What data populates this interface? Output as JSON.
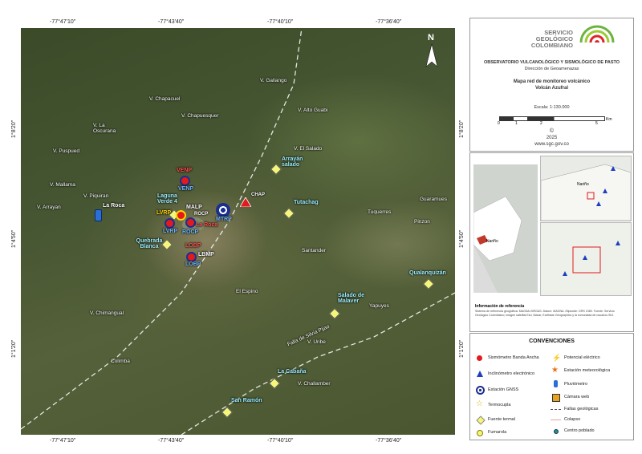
{
  "coords": {
    "top": [
      "-77°47'10\"",
      "-77°43'40\"",
      "-77°40'10\"",
      "-77°36'40\""
    ],
    "bottom": [
      "-77°47'10\"",
      "-77°43'40\"",
      "-77°40'10\"",
      "-77°36'40\""
    ],
    "left": [
      "1°8'20\"",
      "1°4'50\"",
      "1°1'20\""
    ],
    "right": [
      "1°8'20\"",
      "1°4'50\"",
      "1°1'20\""
    ]
  },
  "north": "N",
  "places": [
    "V. Chapacuel",
    "V. Chapuesquer",
    "V. Gallango",
    "V. Alto Guabi",
    "V. El Salado",
    "V. La Oscurana",
    "V. Puspued",
    "V. Mallama",
    "V. Piquiran",
    "V. Arrayan",
    "Guaramues",
    "Tuquerres",
    "Pinzon",
    "Santander",
    "El Espino",
    "Yapuyes",
    "V. Chimangual",
    "V. Uribe",
    "Colimba",
    "V. Challamber"
  ],
  "sites": {
    "arrayan": "Arrayán salado",
    "tutachag": "Tutachag",
    "laguna": "Laguna Verde 4",
    "laroca_gauge": "La Roca",
    "laroca": "La Roca",
    "quebrada": "Quebrada Blanca",
    "salado": "Salado de Malaver",
    "qualanquizan": "Qualanquizán",
    "cabana": "La Cabaña",
    "sanramon": "San Ramón",
    "falla": "Falla de Silvia Pijao"
  },
  "stations": {
    "venp_top": "VENP",
    "venp_bot": "VENP",
    "malp": "MALP",
    "rocp_top": "ROCP",
    "lvrp_top": "LVRP",
    "lvrp_bot": "LVRP",
    "rocp_bot": "ROCP",
    "mtrp": "MTRP",
    "chap": "CHAP",
    "lobp_top": "LOBP",
    "lbmp": "LBMP",
    "lobp_bot": "LOBP"
  },
  "title": {
    "org_line1": "SERVICIO",
    "org_line2": "GEOLÓGICO",
    "org_line3": "COLOMBIANO",
    "observatory": "OBSERVATORIO VULCANOLÓGICO Y SISMOLÓGICO DE PASTO",
    "direction": "Dirección de Geoamenazas",
    "map_title": "Mapa red de monitoreo volcánico",
    "volcano": "Volcán Azufral",
    "scale": "Escala: 1:130.000",
    "scale_ticks": [
      "0",
      "1",
      "2",
      "5"
    ],
    "scale_unit": "Km",
    "copyright": "©",
    "year": "2025",
    "url": "www.sgc.gov.co"
  },
  "reference": {
    "inset_label_1": "Nariño",
    "inset_label_2": "Nariño",
    "heading": "Información de referencia",
    "text": "Sistema de referencia geográfica: MAGNA-SIRGAS. Datum: MAGNA. Elipsoide: GRS 1980. Fuente: Servicio Geológico Colombiano; imagen satelital Esri, Maxar, Earthstar Geographics y la comunidad de usuarios SIG."
  },
  "legend": {
    "heading": "CONVENCIONES",
    "items_left": [
      "Sismómetro Banda Ancha",
      "Inclinómetro electrónico",
      "Estación GNSS",
      "Termocupla",
      "Fuente termal",
      "Fumarola"
    ],
    "items_right": [
      "Potencial eléctrico",
      "Estación meteorológica",
      "Pluviómetro",
      "Cámara web",
      "Fallas geológicas",
      "Colapso",
      "Centro poblado"
    ]
  },
  "colors": {
    "seismometer": "#e31a1c",
    "inclinometer": "#1f3fbf",
    "gnss": "#1b2f8f",
    "thermal_spring": "#f4f77a",
    "logo_green": "#6cb33f",
    "logo_red": "#e0262d",
    "fault": "#ffffff"
  }
}
